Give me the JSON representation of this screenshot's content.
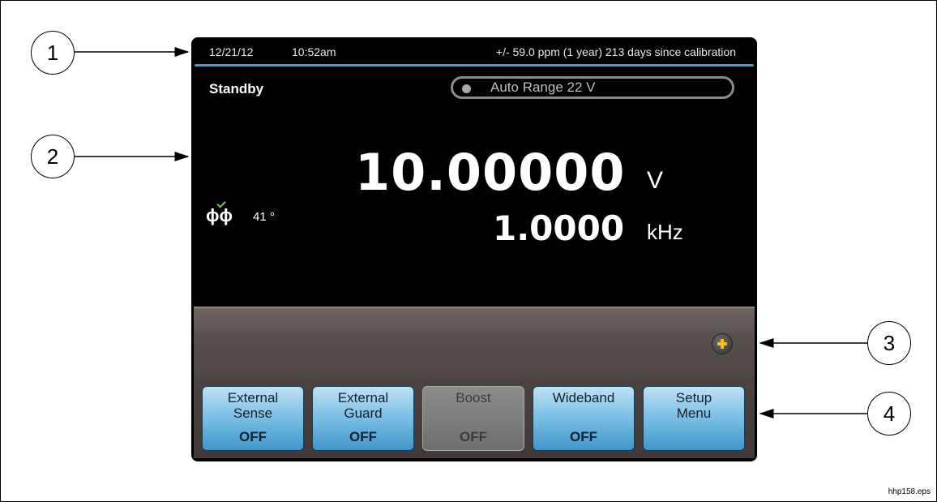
{
  "status_bar": {
    "date": "12/21/12",
    "time": "10:52am",
    "calibration": "+/- 59.0 ppm (1 year)  213 days since calibration"
  },
  "display": {
    "mode": "Standby",
    "range": "Auto Range 22 V",
    "main_value": "10.00000",
    "main_unit": "V",
    "freq_value": "1.0000",
    "freq_unit": "kHz",
    "phase_icon": "ϕϕ",
    "phase_value": "41 °"
  },
  "softkeys": [
    {
      "line1": "External",
      "line2": "Sense",
      "state": "OFF",
      "enabled": true
    },
    {
      "line1": "External",
      "line2": "Guard",
      "state": "OFF",
      "enabled": true
    },
    {
      "line1": "Boost",
      "line2": "",
      "state": "OFF",
      "enabled": false
    },
    {
      "line1": "Wideband",
      "line2": "",
      "state": "OFF",
      "enabled": true
    },
    {
      "line1": "Setup",
      "line2": "Menu",
      "state": "",
      "enabled": true
    }
  ],
  "callouts": [
    "1",
    "2",
    "3",
    "4"
  ],
  "figure_ref": "hhp158.eps",
  "colors": {
    "accent_line": "#3aa3e0",
    "softkey_blue": "#7fc1e6",
    "plus_icon": "#f6c21a",
    "phase_check": "#7ec242"
  },
  "icons": [
    "plus-icon",
    "phase-icon",
    "range-indicator-dot"
  ]
}
